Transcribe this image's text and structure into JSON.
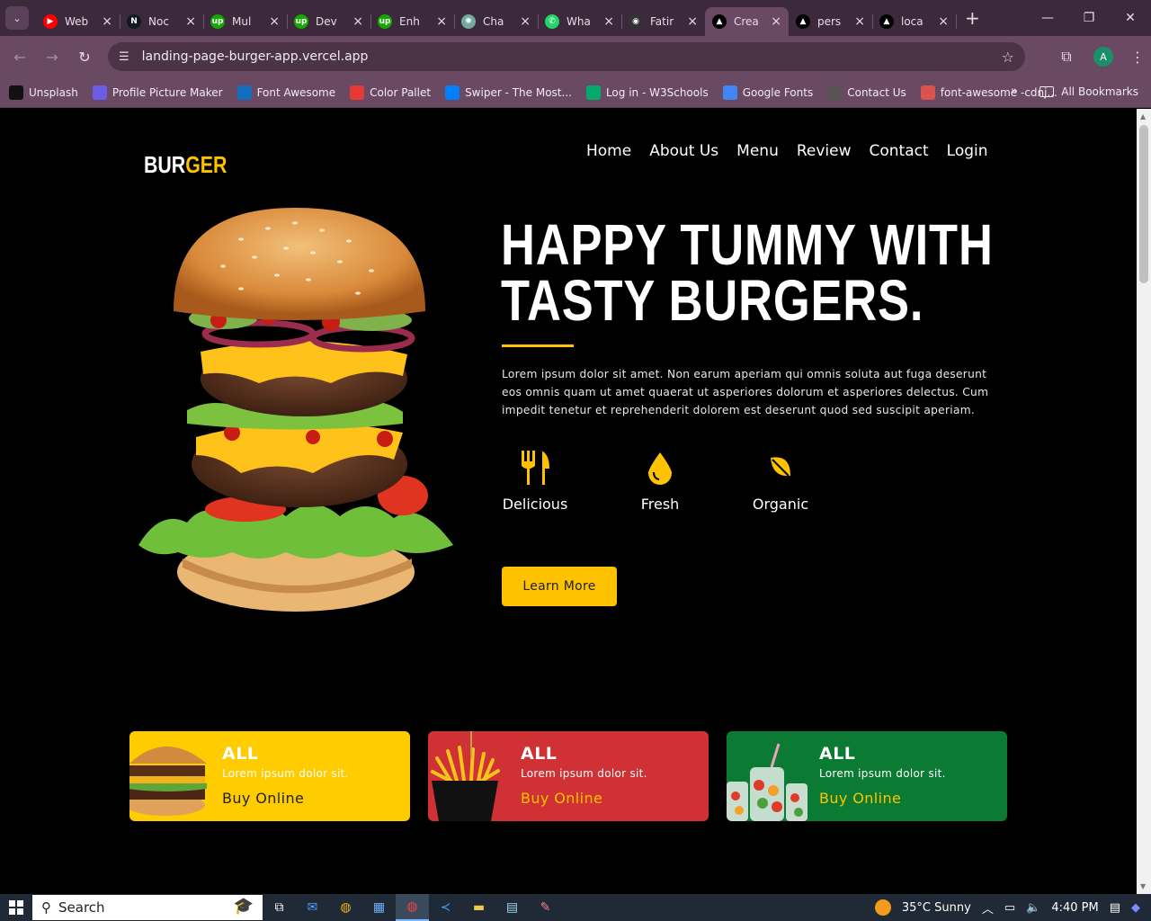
{
  "browser": {
    "tabs": [
      {
        "title": "Web",
        "icon": "youtube-icon",
        "color": "#ff0000",
        "glyph": "▶"
      },
      {
        "title": "Noc",
        "icon": "n-icon",
        "color": "#101820",
        "glyph": "N"
      },
      {
        "title": "Mul",
        "icon": "upwork-icon",
        "color": "#14a800",
        "glyph": "up"
      },
      {
        "title": "Dev",
        "icon": "upwork-icon",
        "color": "#14a800",
        "glyph": "up"
      },
      {
        "title": "Enh",
        "icon": "upwork-icon",
        "color": "#14a800",
        "glyph": "up"
      },
      {
        "title": "Cha",
        "icon": "chatgpt-icon",
        "color": "#74aa9c",
        "glyph": "✺"
      },
      {
        "title": "Wha",
        "icon": "whatsapp-icon",
        "color": "#25d366",
        "glyph": "✆"
      },
      {
        "title": "Fatir",
        "icon": "github-icon",
        "color": "#333333",
        "glyph": "◉"
      },
      {
        "title": "Crea",
        "icon": "vercel-icon",
        "color": "#000000",
        "glyph": "▲"
      },
      {
        "title": "pers",
        "icon": "vercel-icon",
        "color": "#000000",
        "glyph": "▲"
      },
      {
        "title": "loca",
        "icon": "vercel-icon",
        "color": "#000000",
        "glyph": "▲"
      }
    ],
    "url": "landing-page-burger-app.vercel.app",
    "profile_initial": "A",
    "bookmarks": [
      {
        "label": "Unsplash",
        "icon": "unsplash-icon",
        "color": "#111111"
      },
      {
        "label": "Profile Picture Maker",
        "icon": "profile-maker-icon",
        "color": "#6c5ce7"
      },
      {
        "label": "Font Awesome",
        "icon": "font-awesome-icon",
        "color": "#146ebe"
      },
      {
        "label": "Color Pallet",
        "icon": "color-pallet-icon",
        "color": "#e53935"
      },
      {
        "label": "Swiper - The Most...",
        "icon": "swiper-icon",
        "color": "#0080ff"
      },
      {
        "label": "Log in - W3Schools",
        "icon": "w3schools-icon",
        "color": "#04aa6d"
      },
      {
        "label": "Google Fonts",
        "icon": "google-fonts-icon",
        "color": "#4285f4"
      },
      {
        "label": "Contact Us",
        "icon": "globe-icon",
        "color": "#555555"
      },
      {
        "label": "font-awesome -cdnj...",
        "icon": "code-icon",
        "color": "#d9534f"
      }
    ],
    "all_bookmarks_label": "All Bookmarks"
  },
  "site": {
    "logo_white": "BUR",
    "logo_yellow": "GER",
    "nav": [
      "Home",
      "About Us",
      "Menu",
      "Review",
      "Contact",
      "Login"
    ],
    "hero_title_line1": "HAPPY TUMMY WITH",
    "hero_title_line2": "TASTY BURGERS.",
    "hero_text": "Lorem ipsum dolor sit amet. Non earum aperiam qui omnis soluta aut fuga deserunt eos omnis quam ut amet quaerat ut asperiores dolorum et asperiores delectus. Cum impedit tenetur et reprehenderit dolorem est deserunt quod sed suscipit aperiam.",
    "features": [
      {
        "label": "Delicious",
        "icon": "utensils-icon"
      },
      {
        "label": "Fresh",
        "icon": "droplet-icon"
      },
      {
        "label": "Organic",
        "icon": "leaf-icon"
      }
    ],
    "cta_label": "Learn More",
    "accent": "#ffc200",
    "cards": [
      {
        "title": "ALL",
        "subtitle": "Lorem ipsum dolor sit.",
        "button": "Buy Online",
        "bg": "#ffcc00",
        "button_color": "#222222",
        "image": "burger-image"
      },
      {
        "title": "ALL",
        "subtitle": "Lorem ipsum dolor sit.",
        "button": "Buy Online",
        "bg": "#cf3134",
        "button_color": "#ffc200",
        "image": "fries-image"
      },
      {
        "title": "ALL",
        "subtitle": "Lorem ipsum dolor sit.",
        "button": "Buy Online",
        "bg": "#0b7a33",
        "button_color": "#ffc200",
        "image": "drinks-image"
      }
    ]
  },
  "taskbar": {
    "search_placeholder": "Search",
    "weather": "35°C  Sunny",
    "time": "4:40 PM"
  }
}
